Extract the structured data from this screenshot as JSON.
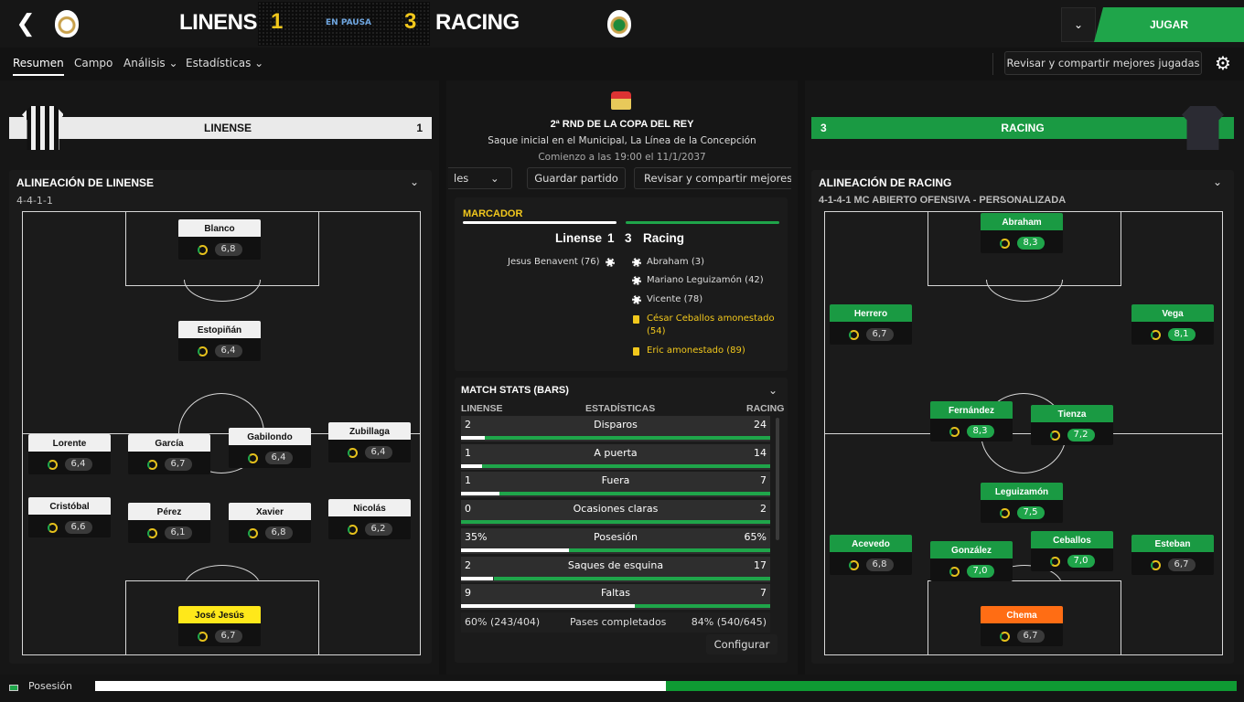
{
  "header": {
    "home_team": "LINENSE",
    "away_team": "RACING",
    "home_score": "1",
    "away_score": "3",
    "status": "EN PAUSA",
    "play_button": "JUGAR",
    "dropdown_icon": "chevron-down-icon",
    "back_icon": "chevron-left-icon"
  },
  "tabs": [
    {
      "label": "Resumen"
    },
    {
      "label": "Campo"
    },
    {
      "label": "Análisis ⌄"
    },
    {
      "label": "Estadísticas ⌄"
    }
  ],
  "toolbar": {
    "share_label": "Revisar y compartir mejores jugadas"
  },
  "home_panel": {
    "bar_name": "LINENSE",
    "bar_score": "1",
    "lineup_title": "ALINEACIÓN DE LINENSE",
    "formation": "4-4-1-1",
    "players": [
      {
        "name": "Blanco",
        "rating": "6,8"
      },
      {
        "name": "Estopiñán",
        "rating": "6,4"
      },
      {
        "name": "Lorente",
        "rating": "6,4"
      },
      {
        "name": "García",
        "rating": "6,7"
      },
      {
        "name": "Gabilondo",
        "rating": "6,4"
      },
      {
        "name": "Zubillaga",
        "rating": "6,4"
      },
      {
        "name": "Cristóbal",
        "rating": "6,6"
      },
      {
        "name": "Pérez",
        "rating": "6,1"
      },
      {
        "name": "Xavier",
        "rating": "6,8"
      },
      {
        "name": "Nicolás",
        "rating": "6,2"
      },
      {
        "name": "José Jesús",
        "rating": "6,7"
      }
    ]
  },
  "away_panel": {
    "bar_name": "RACING",
    "bar_score": "3",
    "lineup_title": "ALINEACIÓN DE RACING",
    "formation": "4-1-4-1 MC ABIERTO OFENSIVA - PERSONALIZADA",
    "players": [
      {
        "name": "Abraham",
        "rating": "8,3"
      },
      {
        "name": "Herrero",
        "rating": "6,7"
      },
      {
        "name": "Vega",
        "rating": "8,1"
      },
      {
        "name": "Fernández",
        "rating": "8,3"
      },
      {
        "name": "Tienza",
        "rating": "7,2"
      },
      {
        "name": "Leguizamón",
        "rating": "7,5"
      },
      {
        "name": "Acevedo",
        "rating": "6,8"
      },
      {
        "name": "González",
        "rating": "7,0"
      },
      {
        "name": "Ceballos",
        "rating": "7,0"
      },
      {
        "name": "Esteban",
        "rating": "6,7"
      },
      {
        "name": "Chema",
        "rating": "6,7"
      }
    ]
  },
  "center": {
    "competition": "2ª RND DE LA COPA DEL REY",
    "venue": "Saque inicial en el Municipal, La Línea de la Concepción",
    "kickoff": "Comienzo a las 19:00 el 11/1/2037",
    "btn_partial": "les",
    "btn_save": "Guardar partido",
    "btn_share": "Revisar y compartir mejores ju",
    "marcador": {
      "title": "MARCADOR",
      "home": "Linense",
      "home_score": "1",
      "away_score": "3",
      "away": "Racing",
      "home_events": [
        {
          "text": "Jesus Benavent (76)",
          "type": "goal"
        }
      ],
      "away_events": [
        {
          "text": "Abraham (3)",
          "type": "goal"
        },
        {
          "text": "Mariano Leguizamón (42)",
          "type": "goal"
        },
        {
          "text": "Vicente (78)",
          "type": "goal"
        },
        {
          "text": "César Ceballos amonestado",
          "text2": "(54)",
          "type": "yellow"
        },
        {
          "text": "Eric amonestado (89)",
          "type": "yellow"
        }
      ]
    },
    "stats": {
      "title": "MATCH STATS (BARS)",
      "col_home": "LINENSE",
      "col_mid": "ESTADÍSTICAS",
      "col_away": "RACING",
      "rows": [
        {
          "label": "Disparos",
          "home": "2",
          "away": "24",
          "home_frac": 0.077,
          "away_frac": 0.923
        },
        {
          "label": "A puerta",
          "home": "1",
          "away": "14",
          "home_frac": 0.067,
          "away_frac": 0.933
        },
        {
          "label": "Fuera",
          "home": "1",
          "away": "7",
          "home_frac": 0.125,
          "away_frac": 0.875
        },
        {
          "label": "Ocasiones claras",
          "home": "0",
          "away": "2",
          "home_frac": 0.0,
          "away_frac": 1.0
        },
        {
          "label": "Posesión",
          "home": "35%",
          "away": "65%",
          "home_frac": 0.35,
          "away_frac": 0.65
        },
        {
          "label": "Saques de esquina",
          "home": "2",
          "away": "17",
          "home_frac": 0.105,
          "away_frac": 0.895
        },
        {
          "label": "Faltas",
          "home": "9",
          "away": "7",
          "home_frac": 0.5625,
          "away_frac": 0.4375
        }
      ],
      "pases": {
        "home": "60% (243/404)",
        "label": "Pases completados",
        "away": "84% (540/645)"
      },
      "configure": "Configurar"
    }
  },
  "possession_bar": {
    "label": "Posesión",
    "home_frac": 0.5,
    "home_color": "#ffffff",
    "away_color": "#0f9a33"
  },
  "colors": {
    "accent_green": "#1fa54a",
    "score_yellow": "#f2c81c",
    "gk_home": "#ffe81a",
    "gk_away": "#ff6d14"
  }
}
